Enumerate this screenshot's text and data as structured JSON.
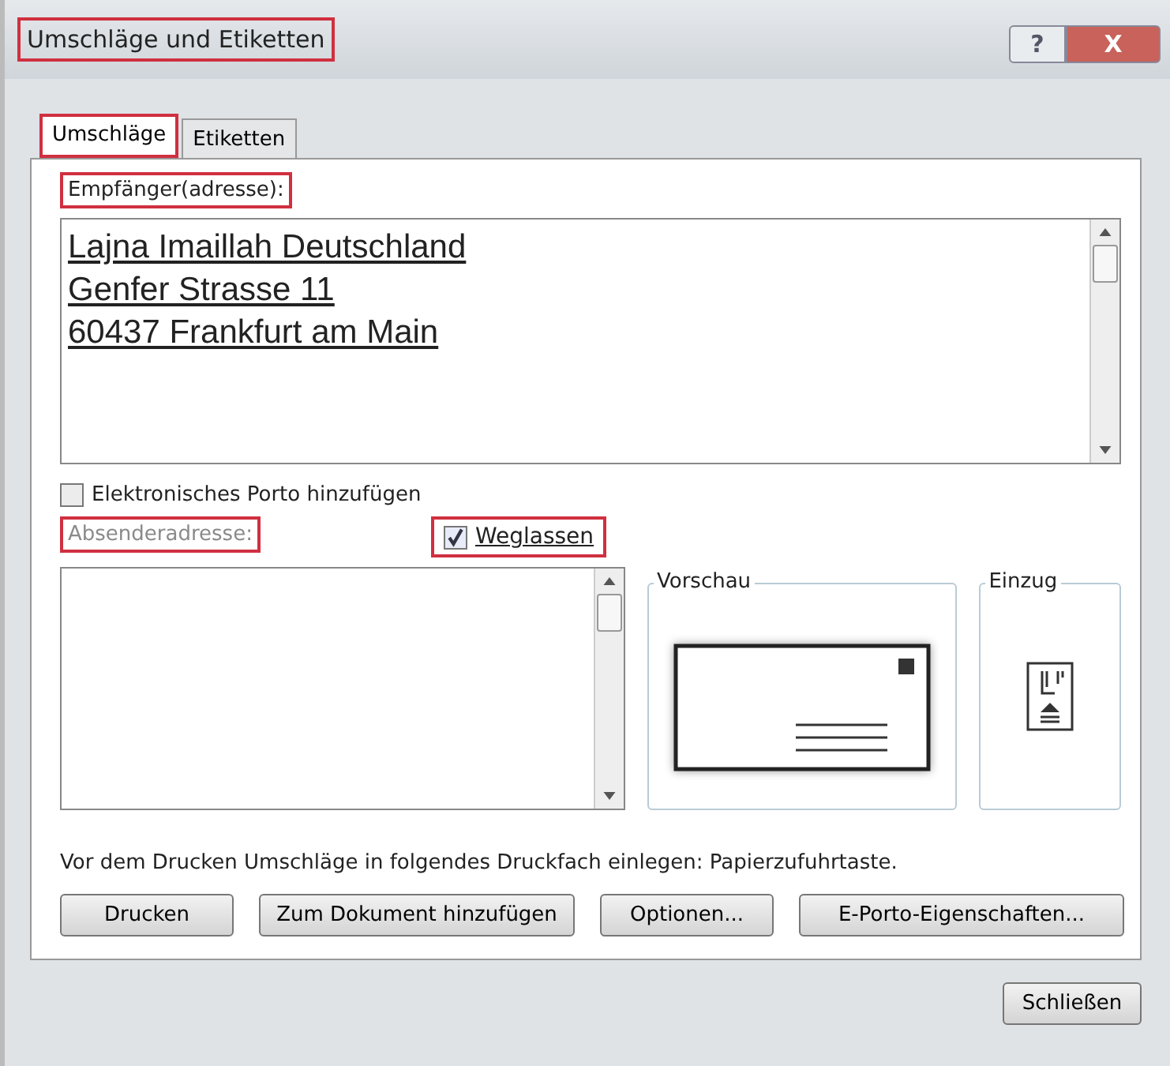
{
  "window": {
    "title": "Umschläge und Etiketten",
    "highlighted": true
  },
  "title_buttons": [
    {
      "kind": "help",
      "label": "?"
    },
    {
      "kind": "close",
      "label": "X"
    }
  ],
  "tabs": [
    {
      "label": "Umschläge",
      "selected": true,
      "highlighted": true
    },
    {
      "label": "Etiketten",
      "selected": false,
      "highlighted": false
    }
  ],
  "recipient": {
    "label": "Empfänger(adresse):",
    "highlighted": true,
    "lines": [
      "Lajna Imaillah Deutschland",
      "Genfer Strasse 11",
      "60437 Frankfurt am Main"
    ]
  },
  "e_porto": {
    "label": "Elektronisches Porto hinzufügen",
    "checked": false
  },
  "sender": {
    "label": "Absenderadresse:",
    "disabled": true,
    "highlighted": true,
    "omit": {
      "label": "Weglassen",
      "checked": true,
      "highlighted": true
    }
  },
  "preview": {
    "label": "Vorschau"
  },
  "feed": {
    "label": "Einzug"
  },
  "info": "Vor dem Drucken Umschläge in folgendes Druckfach einlegen: Papierzufuhrtaste.",
  "buttons": [
    "Drucken",
    "Zum Dokument hinzufügen",
    "Optionen...",
    "E-Porto-Eigenschaften..."
  ],
  "close_button": "Schließen"
}
